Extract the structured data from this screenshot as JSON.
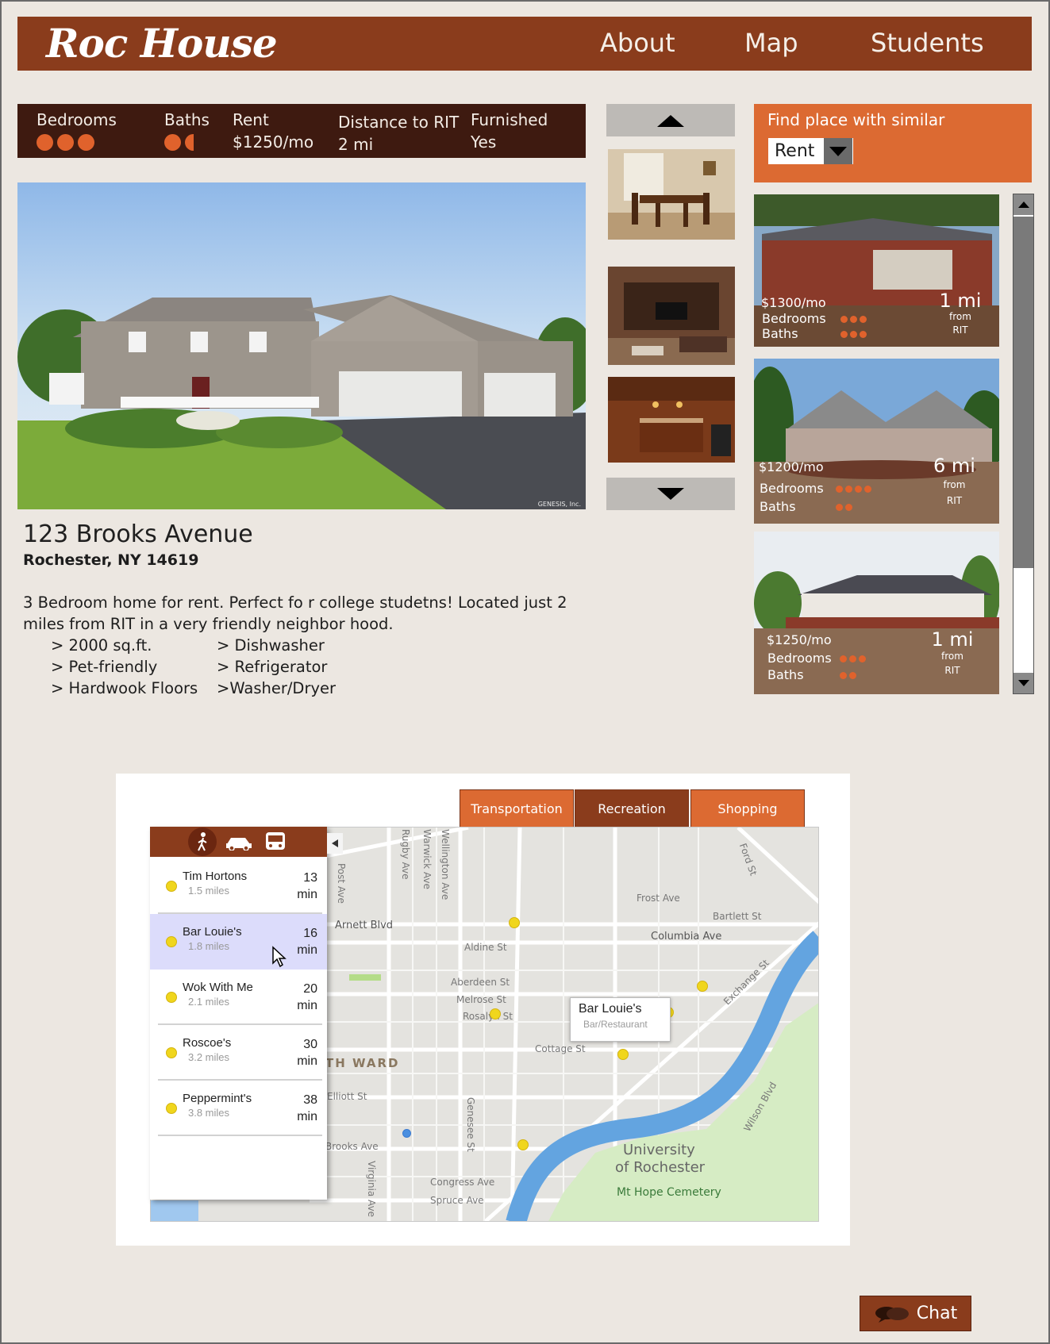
{
  "header": {
    "logo": "Roc House",
    "nav": [
      "About",
      "Map",
      "Students"
    ]
  },
  "specs": {
    "bedrooms_label": "Bedrooms",
    "bedrooms_count": 3,
    "baths_label": "Baths",
    "baths_count": 1.5,
    "rent_label": "Rent",
    "rent_value": "$1250/mo",
    "distance_label": "Distance to RIT",
    "distance_value": "2 mi",
    "furnished_label": "Furnished",
    "furnished_value": "Yes"
  },
  "main_photo": {
    "credit": "GENESIS, Inc."
  },
  "listing": {
    "address": "123 Brooks Avenue",
    "city": "Rochester, NY 14619",
    "description": "3 Bedroom home for rent. Perfect fo r college studetns! Located just 2 miles from RIT in a very friendly neighbor hood.",
    "features": [
      "> 2000 sq.ft.",
      "> Pet-friendly",
      "> Hardwook Floors",
      "> Dishwasher",
      "> Refrigerator",
      ">Washer/Dryer"
    ]
  },
  "similar": {
    "title": "Find place with similar",
    "selected": "Rent",
    "bedrooms_label": "Bedrooms",
    "baths_label": "Baths",
    "from_label": "from",
    "rit_label": "RIT",
    "cards": [
      {
        "price": "$1300/mo",
        "distance": "1 mi",
        "bedrooms": 3,
        "baths": 3
      },
      {
        "price": "$1200/mo",
        "distance": "6 mi",
        "bedrooms": 4,
        "baths": 2
      },
      {
        "price": "$1250/mo",
        "distance": "1 mi",
        "bedrooms": 3,
        "baths": 2
      }
    ]
  },
  "map": {
    "tabs": [
      "Transportation",
      "Recreation",
      "Shopping"
    ],
    "active_tab": "Recreation",
    "places": [
      {
        "name": "Tim Hortons",
        "miles": "1.5 miles",
        "time": "13",
        "unit": "min"
      },
      {
        "name": "Bar Louie's",
        "miles": "1.8 miles",
        "time": "16",
        "unit": "min"
      },
      {
        "name": "Wok With Me",
        "miles": "2.1 miles",
        "time": "20",
        "unit": "min"
      },
      {
        "name": "Roscoe's",
        "miles": "3.2 miles",
        "time": "30",
        "unit": "min"
      },
      {
        "name": "Peppermint's",
        "miles": "3.8 miles",
        "time": "38",
        "unit": "min"
      }
    ],
    "callout": {
      "name": "Bar Louie's",
      "type": "Bar/Restaurant"
    },
    "streets": {
      "frost": "Frost Ave",
      "bartlett": "Bartlett St",
      "columbia": "Columbia Ave",
      "arnett": "Arnett Blvd",
      "aldine": "Aldine St",
      "aberdeen": "Aberdeen St",
      "melrose": "Melrose St",
      "rosalyn": "Rosalyn St",
      "cottage": "Cottage St",
      "ward": "TH WARD",
      "elliott": "Elliott St",
      "brooks": "Brooks Ave",
      "congress": "Congress Ave",
      "spruce": "Spruce Ave",
      "genesee": "Genesee St",
      "exchange": "Exchange St",
      "wilson": "Wilson Blvd",
      "ford": "Ford St",
      "post": "Post Ave",
      "rugby": "Rugby Ave",
      "warwick": "Warwick Ave",
      "wellington": "Wellington Ave",
      "virginia": "Virginia Ave",
      "university": "University",
      "of_rochester": "of Rochester",
      "cemetery": "Mt Hope Cemetery"
    }
  },
  "chat": {
    "label": "Chat"
  },
  "colors": {
    "brand": "#8a3c1c",
    "accent": "#dc6a32",
    "dark": "#3e1a10",
    "background": "#ece7e1"
  }
}
